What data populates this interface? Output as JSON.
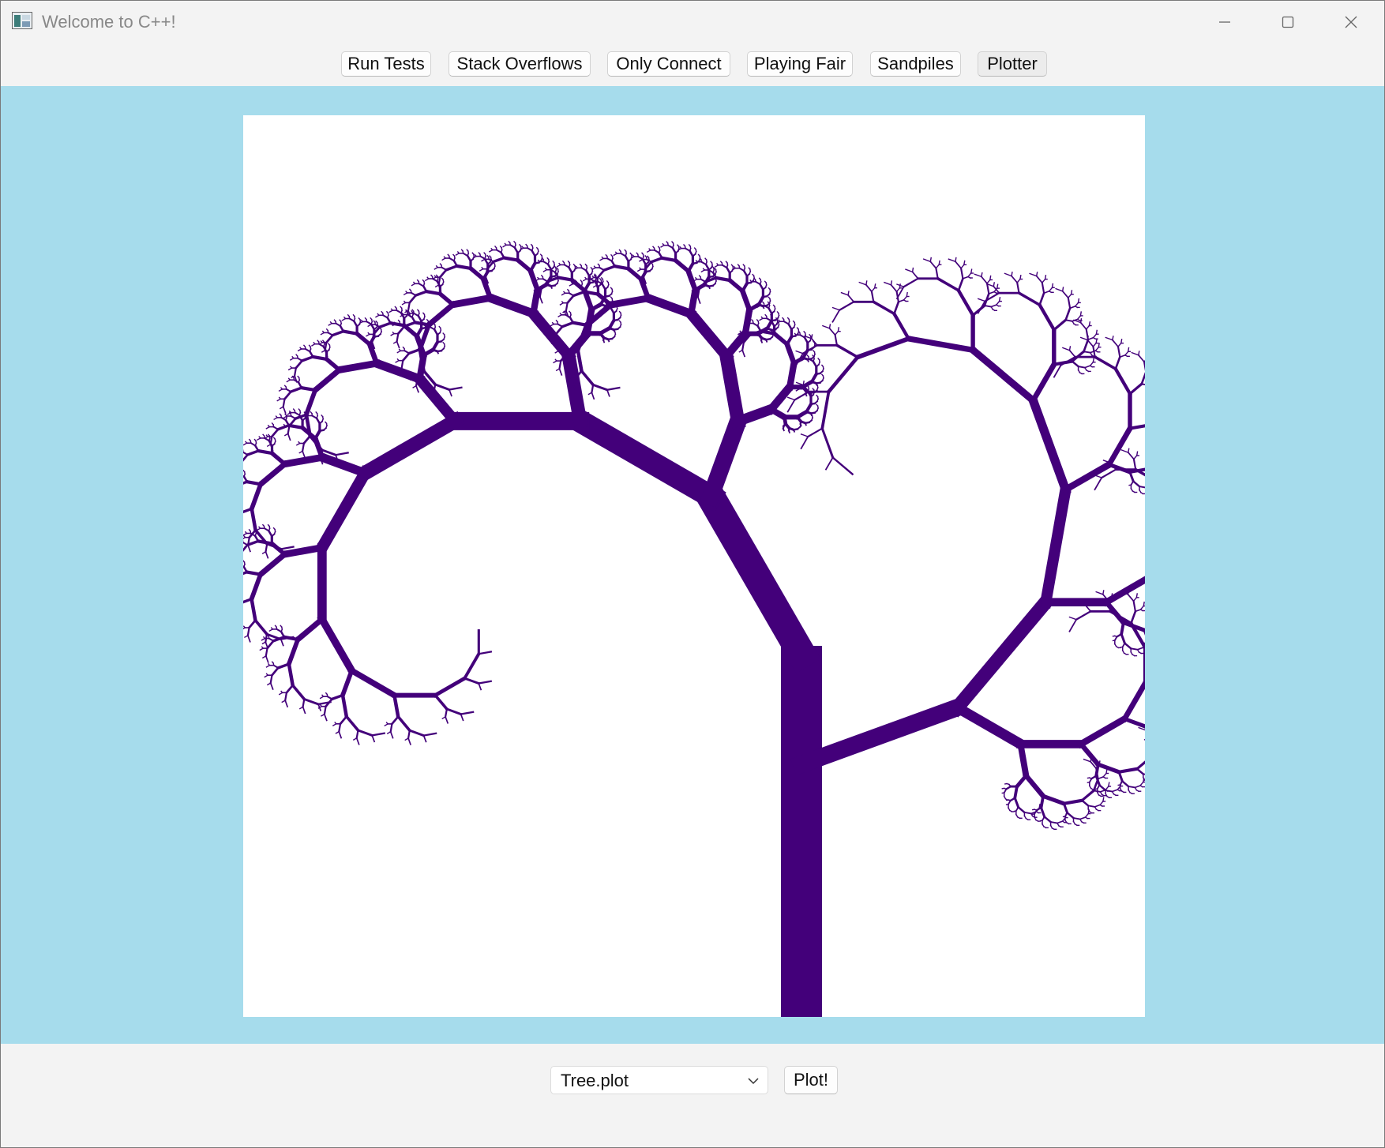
{
  "window": {
    "title": "Welcome to C++!"
  },
  "toolbar": {
    "buttons": [
      "Run Tests",
      "Stack Overflows",
      "Only Connect",
      "Playing Fair",
      "Sandpiles",
      "Plotter"
    ],
    "active": "Plotter"
  },
  "plot": {
    "background": "#ffffff",
    "stroke_color": "#43007a",
    "canvas_background": "#a6dcec"
  },
  "controls": {
    "selected_file": "Tree.plot",
    "plot_button": "Plot!"
  }
}
